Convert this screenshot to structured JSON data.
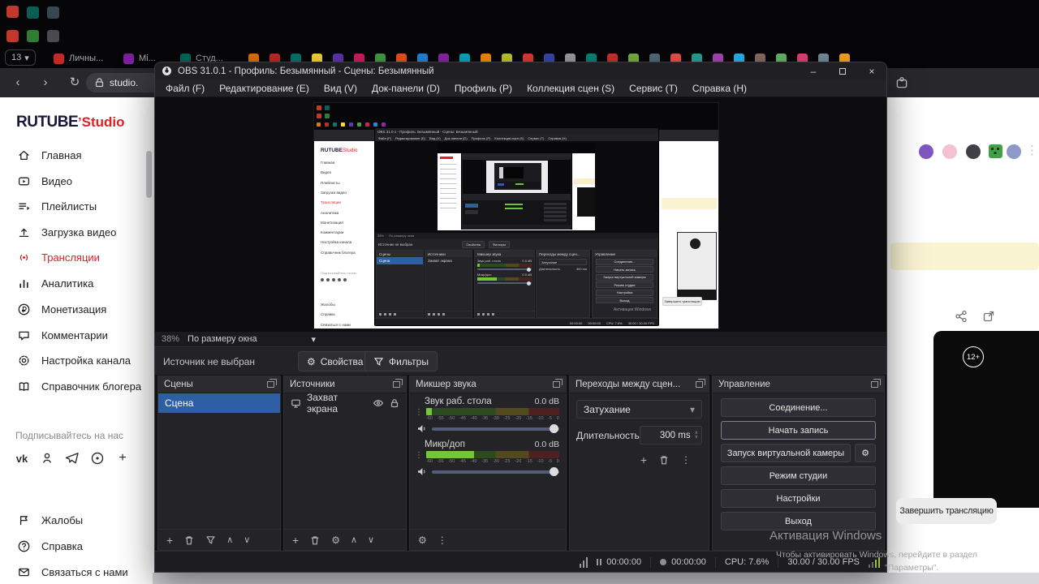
{
  "icons": {
    "back": "‹",
    "forward": "›",
    "reload": "↻",
    "caret": "▾",
    "dots": "⋮",
    "plus": "+",
    "gear": "⚙",
    "chevron_up": "∧",
    "chevron_down": "∨",
    "close": "×",
    "minimize": "–"
  },
  "browser": {
    "tab_counter": "13",
    "tab_labels": [
      "Личны...",
      "Mi...",
      "Студ..."
    ],
    "url": "studio."
  },
  "rutube": {
    "logo_top": "RUTUBE",
    "logo_sub": "Studio",
    "menu": [
      "Главная",
      "Видео",
      "Плейлисты",
      "Загрузка видео",
      "Трансляции",
      "Аналитика",
      "Монетизация",
      "Комментарии",
      "Настройка канала",
      "Справочник блогера"
    ],
    "subscribe": "Подписывайтесь на нас",
    "footer": [
      "Жалобы",
      "Справка",
      "Связаться с нами"
    ]
  },
  "obs": {
    "title": "OBS 31.0.1 - Профиль: Безымянный - Сцены: Безымянный",
    "menu": [
      "Файл (F)",
      "Редактирование (E)",
      "Вид (V)",
      "Док-панели (D)",
      "Профиль (P)",
      "Коллекция сцен (S)",
      "Сервис (T)",
      "Справка (H)"
    ],
    "zoom_percent": "38%",
    "zoom_fit": "По размеру окна",
    "context": {
      "no_source": "Источник не выбран",
      "properties": "Свойства",
      "filters": "Фильтры"
    },
    "scenes": {
      "title": "Сцены",
      "item": "Сцена"
    },
    "sources": {
      "title": "Источники",
      "item": "Захват экрана"
    },
    "mixer": {
      "title": "Микшер звука",
      "ch1": {
        "name": "Звук раб. стола",
        "db": "0.0 dB"
      },
      "ch2": {
        "name": "Микр/доп",
        "db": "0.0 dB"
      },
      "ticks": [
        "-60",
        "-55",
        "-50",
        "-45",
        "-40",
        "-35",
        "-30",
        "-25",
        "-20",
        "-15",
        "-10",
        "-5",
        "0"
      ]
    },
    "transitions": {
      "title": "Переходы между сцен...",
      "type": "Затухание",
      "duration_label": "Длительность",
      "duration": "300 ms"
    },
    "controls": {
      "title": "Управление",
      "buttons": [
        "Соединение...",
        "Начать запись",
        "Запуск виртуальной камеры",
        "Режим студии",
        "Настройки",
        "Выход"
      ]
    },
    "status": {
      "t1": "00:00:00",
      "t2": "00:00:00",
      "cpu": "CPU: 7.6%",
      "fps": "30.00 / 30.00 FPS"
    },
    "levels": {
      "desktop_meter": "4%",
      "mic_meter": "36%",
      "volume": "96%"
    }
  },
  "page_right": {
    "age_badge": "12+",
    "end_button": "Завершить трансляцию"
  },
  "watermark": {
    "l1": "Активация Windows",
    "l2": "Чтобы активировать Windows, перейдите в раздел",
    "l3": "\"Параметры\"."
  }
}
